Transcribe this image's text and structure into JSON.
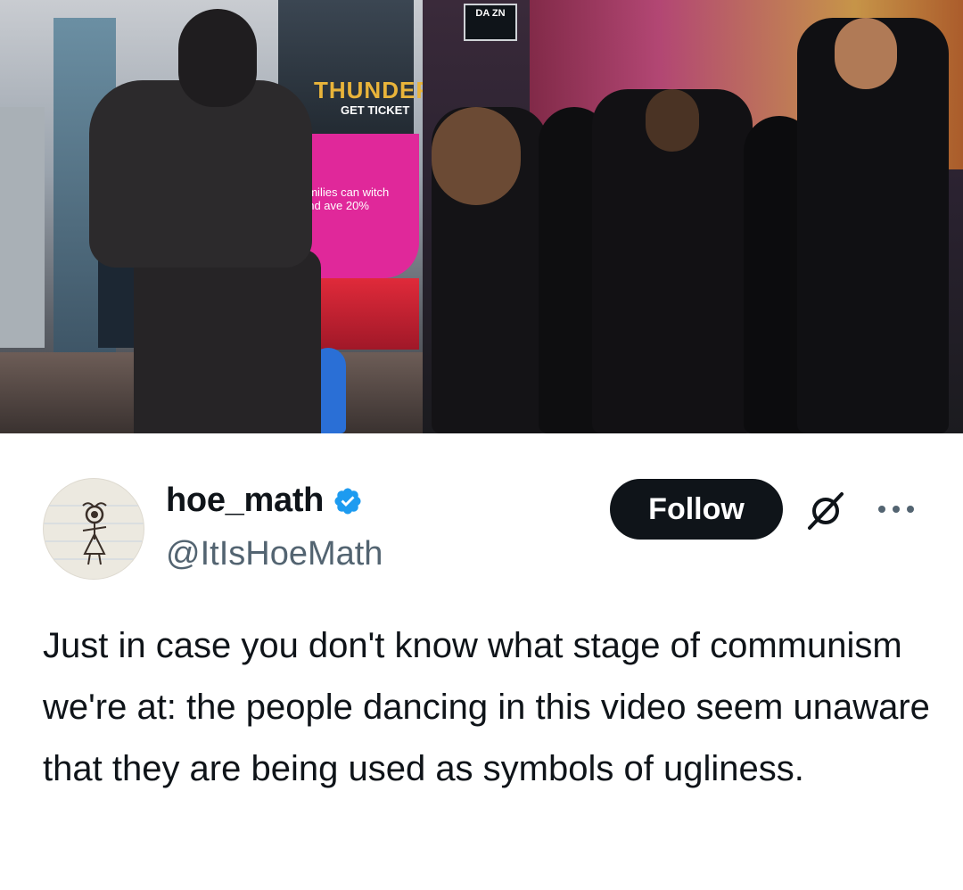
{
  "media": {
    "left_image": {
      "billboard_title": "THUNDER",
      "billboard_subtitle": "GET TICKET",
      "pink_ad_text": "amilies can witch and ave 20%"
    },
    "right_image": {
      "logo_text": "DA ZN"
    }
  },
  "author": {
    "display_name": "hoe_math",
    "handle": "@ItIsHoeMath",
    "verified": true,
    "verified_color": "#1d9bf0"
  },
  "actions": {
    "follow_label": "Follow",
    "grok_icon": "grok-icon",
    "more_icon": "more-icon"
  },
  "tweet": {
    "text": "Just in case you don't know what stage of communism we're at: the people dancing in this video seem unaware that they are being used as symbols of ugliness."
  }
}
